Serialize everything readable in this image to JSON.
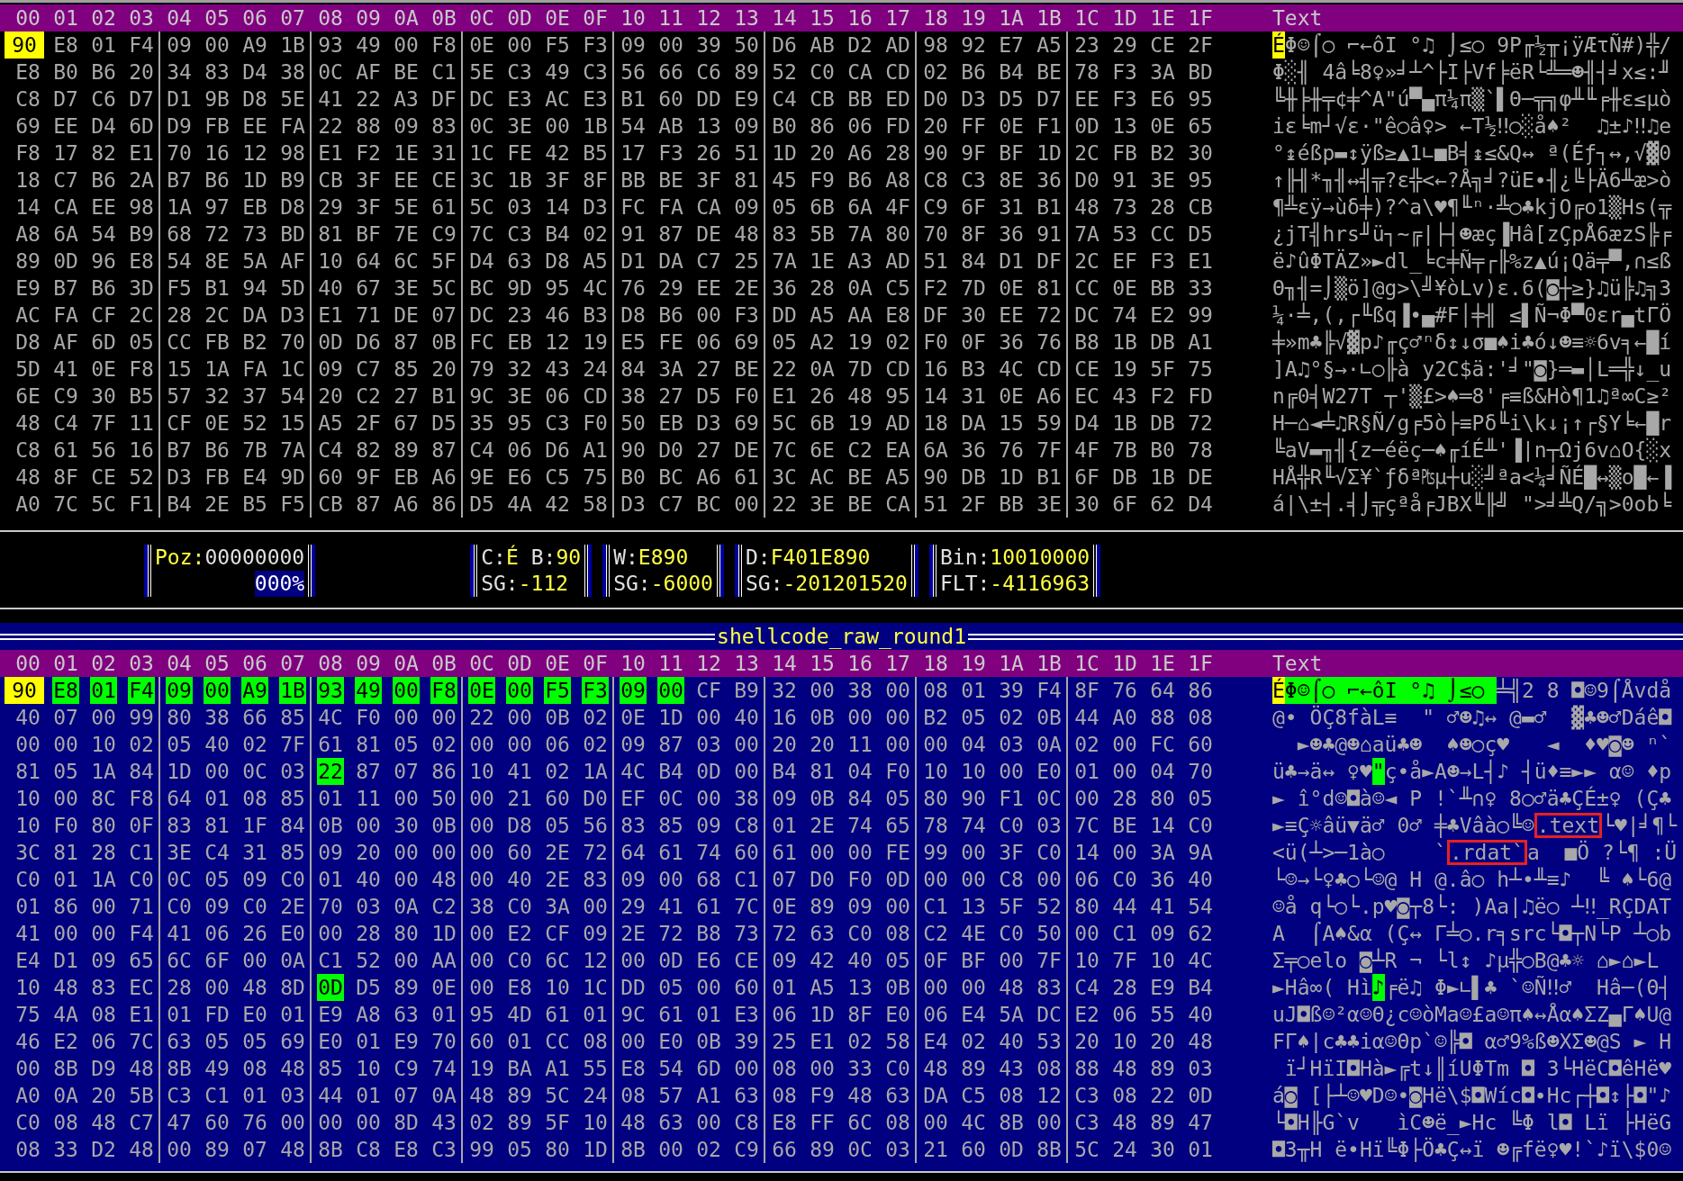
{
  "top_pane": {
    "columns": [
      "00",
      "01",
      "02",
      "03",
      "04",
      "05",
      "06",
      "07",
      "08",
      "09",
      "0A",
      "0B",
      "0C",
      "0D",
      "0E",
      "0F",
      "10",
      "11",
      "12",
      "13",
      "14",
      "15",
      "16",
      "17",
      "18",
      "19",
      "1A",
      "1B",
      "1C",
      "1D",
      "1E",
      "1F"
    ],
    "text_heading": "Text",
    "rows": [
      {
        "hex": [
          "90",
          "E8",
          "01",
          "F4",
          "09",
          "00",
          "A9",
          "1B",
          "93",
          "49",
          "00",
          "F8",
          "0E",
          "00",
          "F5",
          "F3",
          "09",
          "00",
          "39",
          "50",
          "D6",
          "AB",
          "D2",
          "AD",
          "98",
          "92",
          "E7",
          "A5",
          "23",
          "29",
          "CE",
          "2F"
        ],
        "hex_cursor": [
          true,
          false,
          false,
          false,
          false,
          false,
          false,
          false,
          false,
          false,
          false,
          false,
          false,
          false,
          false,
          false,
          false,
          false,
          false,
          false,
          false,
          false,
          false,
          false,
          false,
          false,
          false,
          false,
          false,
          false,
          false,
          false
        ],
        "segments": [
          {
            "text": "É",
            "kind": "cursor"
          },
          {
            "text": "Φ☺⌠○ ⌐←ôI °♫ ⌡≤○ 9P╓½╥¡ÿÆτÑ#)╬/",
            "kind": "plain"
          }
        ]
      },
      {
        "hex": [
          "E8",
          "B0",
          "B6",
          "20",
          "34",
          "83",
          "D4",
          "38",
          "0C",
          "AF",
          "BE",
          "C1",
          "5E",
          "C3",
          "49",
          "C3",
          "56",
          "66",
          "C6",
          "89",
          "52",
          "C0",
          "CA",
          "CD",
          "02",
          "B6",
          "B4",
          "BE",
          "78",
          "F3",
          "3A",
          "BD"
        ],
        "text": "Φ░╢ 4â╘8♀»╛┴^├I├Vf╞ëR└╩═☻╢┤╛x≤:╜"
      },
      {
        "hex": [
          "C8",
          "D7",
          "C6",
          "D7",
          "D1",
          "9B",
          "D8",
          "5E",
          "41",
          "22",
          "A3",
          "DF",
          "DC",
          "E3",
          "AC",
          "E3",
          "B1",
          "60",
          "DD",
          "E9",
          "C4",
          "CB",
          "BB",
          "ED",
          "D0",
          "D3",
          "D5",
          "D7",
          "EE",
          "F3",
          "E6",
          "95"
        ],
        "text": "╚╫╞╫╤¢╪^A\"ú▀▄π¼π▒`▌Θ─╦╗φ╨╙╒╫ε≤µò"
      },
      {
        "hex": [
          "69",
          "EE",
          "D4",
          "6D",
          "D9",
          "FB",
          "EE",
          "FA",
          "22",
          "88",
          "09",
          "83",
          "0C",
          "3E",
          "00",
          "1B",
          "54",
          "AB",
          "13",
          "09",
          "B0",
          "86",
          "06",
          "FD",
          "20",
          "FF",
          "0E",
          "F1",
          "0D",
          "13",
          "0E",
          "65"
        ],
        "text": "iε╘m┘√ε·\"ê○â♀> ←T½‼○░å♠²  ♫±♪‼♫e"
      },
      {
        "hex": [
          "F8",
          "17",
          "82",
          "E1",
          "70",
          "16",
          "12",
          "98",
          "E1",
          "F2",
          "1E",
          "31",
          "1C",
          "FE",
          "42",
          "B5",
          "17",
          "F3",
          "26",
          "51",
          "1D",
          "20",
          "A6",
          "28",
          "90",
          "9F",
          "BF",
          "1D",
          "2C",
          "FB",
          "B2",
          "30"
        ],
        "text": "°↨éßp▬↕ÿß≥▲1∟■B╡↨≤&Q↔ ª(Éƒ┐↔,√▓0"
      },
      {
        "hex": [
          "18",
          "C7",
          "B6",
          "2A",
          "B7",
          "B6",
          "1D",
          "B9",
          "CB",
          "3F",
          "EE",
          "CE",
          "3C",
          "1B",
          "3F",
          "8F",
          "BB",
          "BE",
          "3F",
          "81",
          "45",
          "F9",
          "B6",
          "A8",
          "C8",
          "C3",
          "8E",
          "36",
          "D0",
          "91",
          "3E",
          "95"
        ],
        "text": "↑╟╢*╖╢↔╣╦?ε╬<←?Å╗╛?üE∙╢¿╚├Ä6╨æ>ò"
      },
      {
        "hex": [
          "14",
          "CA",
          "EE",
          "98",
          "1A",
          "97",
          "EB",
          "D8",
          "29",
          "3F",
          "5E",
          "61",
          "5C",
          "03",
          "14",
          "D3",
          "FC",
          "FA",
          "CA",
          "09",
          "05",
          "6B",
          "6A",
          "4F",
          "C9",
          "6F",
          "31",
          "B1",
          "48",
          "73",
          "28",
          "CB"
        ],
        "text": "¶╩εÿ→ùδ╪)?^a\\♥¶╙ⁿ·╩○♣kjO╔o1▒Hs(╦"
      },
      {
        "hex": [
          "A8",
          "6A",
          "54",
          "B9",
          "68",
          "72",
          "73",
          "BD",
          "81",
          "BF",
          "7E",
          "C9",
          "7C",
          "C3",
          "B4",
          "02",
          "91",
          "87",
          "DE",
          "48",
          "83",
          "5B",
          "7A",
          "80",
          "70",
          "8F",
          "36",
          "91",
          "7A",
          "53",
          "CC",
          "D5"
        ],
        "text": "¿jT╣hrs╜ü┐~╔|├┤☻æç▐Hâ[zÇpÅ6æzS╠╒"
      },
      {
        "hex": [
          "89",
          "0D",
          "96",
          "E8",
          "54",
          "8E",
          "5A",
          "AF",
          "10",
          "64",
          "6C",
          "5F",
          "D4",
          "63",
          "D8",
          "A5",
          "D1",
          "DA",
          "C7",
          "25",
          "7A",
          "1E",
          "A3",
          "AD",
          "51",
          "84",
          "D1",
          "DF",
          "2C",
          "EF",
          "F3",
          "E1"
        ],
        "text": "ë♪ûΦTÄZ»►dl_╘c╪Ñ╤┌╟%z▲ú¡Qä╤▀,∩≤ß"
      },
      {
        "hex": [
          "E9",
          "B7",
          "B6",
          "3D",
          "F5",
          "B1",
          "94",
          "5D",
          "40",
          "67",
          "3E",
          "5C",
          "BC",
          "9D",
          "95",
          "4C",
          "76",
          "29",
          "EE",
          "2E",
          "36",
          "28",
          "0A",
          "C5",
          "F2",
          "7D",
          "0E",
          "81",
          "CC",
          "0E",
          "BB",
          "33"
        ],
        "text": "Θ╖╢=⌡▒ö]@g>\\╝¥òLv)ε.6(◙┼≥}♫ü╠♫╗3"
      },
      {
        "hex": [
          "AC",
          "FA",
          "CF",
          "2C",
          "28",
          "2C",
          "DA",
          "D3",
          "E1",
          "71",
          "DE",
          "07",
          "DC",
          "23",
          "46",
          "B3",
          "D8",
          "B6",
          "00",
          "F3",
          "DD",
          "A5",
          "AA",
          "E8",
          "DF",
          "30",
          "EE",
          "72",
          "DC",
          "74",
          "E2",
          "99"
        ],
        "text": "¼·╧,(,┌╙ßq▐•▄#F│╪╢ ≤▌Ñ¬Φ▀0εr▄tΓÖ"
      },
      {
        "hex": [
          "D8",
          "AF",
          "6D",
          "05",
          "CC",
          "FB",
          "B2",
          "70",
          "0D",
          "D6",
          "87",
          "0B",
          "FC",
          "EB",
          "12",
          "19",
          "E5",
          "FE",
          "06",
          "69",
          "05",
          "A2",
          "19",
          "02",
          "F0",
          "0F",
          "36",
          "76",
          "B8",
          "1B",
          "DB",
          "A1"
        ],
        "text": "╪»m♣╠√▓p♪╓ç♂ⁿδ↕↓σ■♠i♣ó↓☻≡☼6v╕←█í"
      },
      {
        "hex": [
          "5D",
          "41",
          "0E",
          "F8",
          "15",
          "1A",
          "FA",
          "1C",
          "09",
          "C7",
          "85",
          "20",
          "79",
          "32",
          "43",
          "24",
          "84",
          "3A",
          "27",
          "BE",
          "22",
          "0A",
          "7D",
          "CD",
          "16",
          "B3",
          "4C",
          "CD",
          "CE",
          "19",
          "5F",
          "75"
        ],
        "text": "]A♫°§→·∟○╟à y2C$ä:'╛\"◙}═▬│L═╬↓_u"
      },
      {
        "hex": [
          "6E",
          "C9",
          "30",
          "B5",
          "57",
          "32",
          "37",
          "54",
          "20",
          "C2",
          "27",
          "B1",
          "9C",
          "3E",
          "06",
          "CD",
          "38",
          "27",
          "D5",
          "F0",
          "E1",
          "26",
          "48",
          "95",
          "14",
          "31",
          "0E",
          "A6",
          "EC",
          "43",
          "F2",
          "FD"
        ],
        "text": "n╔0╡W27T ┬'▒£>♠═8'╒≡ß&Hò¶1♫ª∞C≥²"
      },
      {
        "hex": [
          "48",
          "C4",
          "7F",
          "11",
          "CF",
          "0E",
          "52",
          "15",
          "A5",
          "2F",
          "67",
          "D5",
          "35",
          "95",
          "C3",
          "F0",
          "50",
          "EB",
          "D3",
          "69",
          "5C",
          "6B",
          "19",
          "AD",
          "18",
          "DA",
          "15",
          "59",
          "D4",
          "1B",
          "DB",
          "72"
        ],
        "text": "H─⌂◄╧♫R§Ñ/g╒5ò├≡Pδ╙i\\k↓¡↑┌§Y╘←█r"
      },
      {
        "hex": [
          "C8",
          "61",
          "56",
          "16",
          "B7",
          "B6",
          "7B",
          "7A",
          "C4",
          "82",
          "89",
          "87",
          "C4",
          "06",
          "D6",
          "A1",
          "90",
          "D0",
          "27",
          "DE",
          "7C",
          "6E",
          "C2",
          "EA",
          "6A",
          "36",
          "76",
          "7F",
          "4F",
          "7B",
          "B0",
          "78"
        ],
        "text": "╚aV▬╖╢{z─éëç─♠╓íÉ╨'▐|n┬Ωj6v⌂O{░x"
      },
      {
        "hex": [
          "48",
          "8F",
          "CE",
          "52",
          "D3",
          "FB",
          "E4",
          "9D",
          "60",
          "9F",
          "EB",
          "A6",
          "9E",
          "E6",
          "C5",
          "75",
          "B0",
          "BC",
          "A6",
          "61",
          "3C",
          "AC",
          "BE",
          "A5",
          "90",
          "DB",
          "1D",
          "B1",
          "6F",
          "DB",
          "1B",
          "DE"
        ],
        "text": "HÅ╬R╙√Σ¥`ƒδª₧µ┼u░╝ªa<¼╛ÑÉ█↔▒o█←▐"
      },
      {
        "hex": [
          "A0",
          "7C",
          "5C",
          "F1",
          "B4",
          "2E",
          "B5",
          "F5",
          "CB",
          "87",
          "A6",
          "86",
          "D5",
          "4A",
          "42",
          "58",
          "D3",
          "C7",
          "BC",
          "00",
          "22",
          "3E",
          "BE",
          "CA",
          "51",
          "2F",
          "BB",
          "3E",
          "30",
          "6F",
          "62",
          "D4"
        ],
        "text": "á|\\±┤.╡⌡╦çªå╒JBX╙╟╝ \">╛╩Q/╗>0ob╘"
      }
    ]
  },
  "status": {
    "boxes": [
      {
        "lines": [
          {
            "parts": [
              {
                "text": "Poz:",
                "kind": "accent"
              },
              {
                "text": "00000000",
                "kind": "plain"
              }
            ]
          },
          {
            "parts": [
              {
                "text": "000%",
                "kind": "inverse"
              }
            ]
          }
        ]
      },
      {
        "lines": [
          {
            "parts": [
              {
                "text": "C:",
                "kind": "label"
              },
              {
                "text": "É",
                "kind": "value"
              },
              {
                "text": "B:",
                "kind": "label"
              },
              {
                "text": "90",
                "kind": "value"
              }
            ]
          },
          {
            "parts": [
              {
                "text": "SG:",
                "kind": "label"
              },
              {
                "text": "-112",
                "kind": "value"
              }
            ]
          }
        ]
      },
      {
        "lines": [
          {
            "parts": [
              {
                "text": "W:",
                "kind": "label"
              },
              {
                "text": "E890",
                "kind": "value"
              }
            ]
          },
          {
            "parts": [
              {
                "text": "SG:",
                "kind": "label"
              },
              {
                "text": "-6000",
                "kind": "value"
              }
            ]
          }
        ]
      },
      {
        "lines": [
          {
            "parts": [
              {
                "text": "D:",
                "kind": "label"
              },
              {
                "text": "F401E890",
                "kind": "value"
              }
            ]
          },
          {
            "parts": [
              {
                "text": "SG:",
                "kind": "label"
              },
              {
                "text": "-201201520",
                "kind": "value"
              }
            ]
          }
        ]
      },
      {
        "lines": [
          {
            "parts": [
              {
                "text": "Bin:",
                "kind": "label"
              },
              {
                "text": "10010000",
                "kind": "value"
              }
            ]
          },
          {
            "parts": [
              {
                "text": "FLT:",
                "kind": "label"
              },
              {
                "text": "-4116963",
                "kind": "value"
              }
            ]
          }
        ]
      }
    ]
  },
  "bottom_pane": {
    "title": "shellcode_raw_round1",
    "columns": [
      "00",
      "01",
      "02",
      "03",
      "04",
      "05",
      "06",
      "07",
      "08",
      "09",
      "0A",
      "0B",
      "0C",
      "0D",
      "0E",
      "0F",
      "10",
      "11",
      "12",
      "13",
      "14",
      "15",
      "16",
      "17",
      "18",
      "19",
      "1A",
      "1B",
      "1C",
      "1D",
      "1E",
      "1F"
    ],
    "text_heading": "Text",
    "rows": [
      {
        "hex": [
          "90",
          "E8",
          "01",
          "F4",
          "09",
          "00",
          "A9",
          "1B",
          "93",
          "49",
          "00",
          "F8",
          "0E",
          "00",
          "F5",
          "F3",
          "09",
          "00",
          "CF",
          "B9",
          "32",
          "00",
          "38",
          "00",
          "08",
          "01",
          "39",
          "F4",
          "8F",
          "76",
          "64",
          "86"
        ],
        "hex_cursor": [
          true,
          false,
          false,
          false,
          false,
          false,
          false,
          false,
          false,
          false,
          false,
          false,
          false,
          false,
          false,
          false,
          false,
          false,
          false,
          false,
          false,
          false,
          false,
          false,
          false,
          false,
          false,
          false,
          false,
          false,
          false,
          false
        ],
        "hex_selected": [
          false,
          true,
          true,
          true,
          true,
          true,
          true,
          true,
          true,
          true,
          true,
          true,
          true,
          true,
          true,
          true,
          true,
          true,
          false,
          false,
          false,
          false,
          false,
          false,
          false,
          false,
          false,
          false,
          false,
          false,
          false,
          false
        ],
        "segments": [
          {
            "text": "É",
            "kind": "cursor"
          },
          {
            "text": "Φ☺⌠○ ⌐←ôI °♫ ⌡≤○ ",
            "kind": "selection"
          },
          {
            "text": "╧╣2 8 ◘☺9⌠Åvdå",
            "kind": "plain"
          }
        ]
      },
      {
        "hex": [
          "40",
          "07",
          "00",
          "99",
          "80",
          "38",
          "66",
          "85",
          "4C",
          "F0",
          "00",
          "00",
          "22",
          "00",
          "0B",
          "02",
          "0E",
          "1D",
          "00",
          "40",
          "16",
          "0B",
          "00",
          "00",
          "B2",
          "05",
          "02",
          "0B",
          "44",
          "A0",
          "88",
          "08"
        ],
        "text": "@• ÖÇ8fàL≡  \" ♂☻♫↔ @▬♂  ▓♣☻♂Dáê◘"
      },
      {
        "hex": [
          "00",
          "00",
          "10",
          "02",
          "05",
          "40",
          "02",
          "7F",
          "61",
          "81",
          "05",
          "02",
          "00",
          "00",
          "06",
          "02",
          "09",
          "87",
          "03",
          "00",
          "20",
          "20",
          "11",
          "00",
          "00",
          "04",
          "03",
          "0A",
          "02",
          "00",
          "FC",
          "60"
        ],
        "text": "  ►☻♣@☻⌂aü♣☻  ♠☻○ç♥   ◄  ♦♥◙☻ ⁿ`"
      },
      {
        "hex": [
          "81",
          "05",
          "1A",
          "84",
          "1D",
          "00",
          "0C",
          "03",
          "22",
          "87",
          "07",
          "86",
          "10",
          "41",
          "02",
          "1A",
          "4C",
          "B4",
          "0D",
          "00",
          "B4",
          "81",
          "04",
          "F0",
          "10",
          "10",
          "00",
          "E0",
          "01",
          "00",
          "04",
          "70"
        ],
        "hex_selected": [
          false,
          false,
          false,
          false,
          false,
          false,
          false,
          false,
          true,
          false,
          false,
          false,
          false,
          false,
          false,
          false,
          false,
          false,
          false,
          false,
          false,
          false,
          false,
          false,
          false,
          false,
          false,
          false,
          false,
          false,
          false,
          false
        ],
        "segments": [
          {
            "text": "ü♣→ä↔ ♀♥",
            "kind": "plain"
          },
          {
            "text": "\"",
            "kind": "selection"
          },
          {
            "text": "ç•å►A☻→L┤♪ ┤ü♦≡►► α☺ ♦p",
            "kind": "plain"
          }
        ]
      },
      {
        "hex": [
          "10",
          "00",
          "8C",
          "F8",
          "64",
          "01",
          "08",
          "85",
          "01",
          "11",
          "00",
          "50",
          "00",
          "21",
          "60",
          "D0",
          "EF",
          "0C",
          "00",
          "38",
          "09",
          "0B",
          "84",
          "05",
          "80",
          "90",
          "F1",
          "0C",
          "00",
          "28",
          "80",
          "05"
        ],
        "text": "► î°d☺◘à☺◄ P !`╨∩♀ 8○♂ä♣ÇÉ±♀ (Ç♣"
      },
      {
        "hex": [
          "10",
          "F0",
          "80",
          "0F",
          "83",
          "81",
          "1F",
          "84",
          "0B",
          "00",
          "30",
          "0B",
          "00",
          "D8",
          "05",
          "56",
          "83",
          "85",
          "09",
          "C8",
          "01",
          "2E",
          "74",
          "65",
          "78",
          "74",
          "C0",
          "03",
          "7C",
          "BE",
          "14",
          "C0"
        ],
        "segments": [
          {
            "text": "►≡Ç☼âü▼ä♂ 0♂ ╪♣Vâà○╚☺",
            "kind": "plain"
          },
          {
            "text": ".text",
            "kind": "annotated"
          },
          {
            "text": "└♥|╛¶└",
            "kind": "plain"
          }
        ]
      },
      {
        "hex": [
          "3C",
          "81",
          "28",
          "C1",
          "3E",
          "C4",
          "31",
          "85",
          "09",
          "20",
          "00",
          "00",
          "00",
          "60",
          "2E",
          "72",
          "64",
          "61",
          "74",
          "60",
          "61",
          "00",
          "00",
          "FE",
          "99",
          "00",
          "3F",
          "C0",
          "14",
          "00",
          "3A",
          "9A"
        ],
        "segments": [
          {
            "text": "<ü(┴>─1à○    `",
            "kind": "plain"
          },
          {
            "text": ".rdat`",
            "kind": "annotated"
          },
          {
            "text": "a  ■Ö ?└¶ :Ü",
            "kind": "plain"
          }
        ]
      },
      {
        "hex": [
          "C0",
          "01",
          "1A",
          "C0",
          "0C",
          "05",
          "09",
          "C0",
          "01",
          "40",
          "00",
          "48",
          "00",
          "40",
          "2E",
          "83",
          "09",
          "00",
          "68",
          "C1",
          "07",
          "D0",
          "F0",
          "0D",
          "00",
          "00",
          "C8",
          "00",
          "06",
          "C0",
          "36",
          "40"
        ],
        "text": "└☺→└♀♣○└☺@ H @.â○ h┴•╨≡♪  ╚ ♠└6@"
      },
      {
        "hex": [
          "01",
          "86",
          "00",
          "71",
          "C0",
          "09",
          "C0",
          "2E",
          "70",
          "03",
          "0A",
          "C2",
          "38",
          "C0",
          "3A",
          "00",
          "29",
          "41",
          "61",
          "7C",
          "0E",
          "89",
          "09",
          "00",
          "C1",
          "13",
          "5F",
          "52",
          "80",
          "44",
          "41",
          "54"
        ],
        "text": "☺å q└○└.p♥◙┬8└: )Aa|♫ë○ ┴‼_RÇDAT"
      },
      {
        "hex": [
          "41",
          "00",
          "00",
          "F4",
          "41",
          "06",
          "26",
          "E0",
          "00",
          "28",
          "80",
          "1D",
          "00",
          "E2",
          "CF",
          "09",
          "2E",
          "72",
          "B8",
          "73",
          "72",
          "63",
          "C0",
          "08",
          "C2",
          "4E",
          "C0",
          "50",
          "00",
          "C1",
          "09",
          "62"
        ],
        "text": "A  ⌠A♠&α (Ç↔ Γ╧○.r╕src└◘┬N└P ┴○b"
      },
      {
        "hex": [
          "E4",
          "D1",
          "09",
          "65",
          "6C",
          "6F",
          "00",
          "0A",
          "C1",
          "52",
          "00",
          "AA",
          "00",
          "C0",
          "6C",
          "12",
          "00",
          "0D",
          "E6",
          "CE",
          "09",
          "42",
          "40",
          "05",
          "0F",
          "BF",
          "00",
          "7F",
          "10",
          "7F",
          "10",
          "4C"
        ],
        "text": "Σ╤○elo ◙┴R ¬ └l↕ ♪µ╬○B@♣☼ ⌂►⌂►L"
      },
      {
        "hex": [
          "10",
          "48",
          "83",
          "EC",
          "28",
          "00",
          "48",
          "8D",
          "0D",
          "D5",
          "89",
          "0E",
          "00",
          "E8",
          "10",
          "1C",
          "DD",
          "05",
          "00",
          "60",
          "01",
          "A5",
          "13",
          "0B",
          "00",
          "00",
          "48",
          "83",
          "C4",
          "28",
          "E9",
          "B4"
        ],
        "hex_selected": [
          false,
          false,
          false,
          false,
          false,
          false,
          false,
          false,
          true,
          false,
          false,
          false,
          false,
          false,
          false,
          false,
          false,
          false,
          false,
          false,
          false,
          false,
          false,
          false,
          false,
          false,
          false,
          false,
          false,
          false,
          false,
          false
        ],
        "segments": [
          {
            "text": "►Hâ∞( Hì",
            "kind": "plain"
          },
          {
            "text": "♪",
            "kind": "selection"
          },
          {
            "text": "╒ë♫ Φ►∟▌♣ `☺Ñ‼♂  Hâ─(Θ┤",
            "kind": "plain"
          }
        ]
      },
      {
        "hex": [
          "75",
          "4A",
          "08",
          "E1",
          "01",
          "FD",
          "E0",
          "01",
          "E9",
          "A8",
          "63",
          "01",
          "95",
          "4D",
          "61",
          "01",
          "9C",
          "61",
          "01",
          "E3",
          "06",
          "1D",
          "8F",
          "E0",
          "06",
          "E4",
          "5A",
          "DC",
          "E2",
          "06",
          "55",
          "40"
        ],
        "text": "uJ◘ß☺²α☺Θ¿c☺òMa☺£a☺π♠↔Åα♠ΣZ▄Γ♠U@"
      },
      {
        "hex": [
          "46",
          "E2",
          "06",
          "7C",
          "63",
          "05",
          "05",
          "69",
          "E0",
          "01",
          "E9",
          "70",
          "60",
          "01",
          "CC",
          "08",
          "00",
          "E0",
          "0B",
          "39",
          "25",
          "E1",
          "02",
          "58",
          "E4",
          "02",
          "40",
          "53",
          "20",
          "10",
          "20",
          "48"
        ],
        "text": "FΓ♠|c♣♣iα☺Θp`☺╠◘ α♂9%ß☻XΣ☻@S ► H"
      },
      {
        "hex": [
          "00",
          "8B",
          "D9",
          "48",
          "8B",
          "49",
          "08",
          "48",
          "85",
          "10",
          "C9",
          "74",
          "19",
          "BA",
          "A1",
          "55",
          "E8",
          "54",
          "6D",
          "00",
          "08",
          "00",
          "33",
          "C0",
          "48",
          "89",
          "43",
          "08",
          "88",
          "48",
          "89",
          "03"
        ],
        "text": " ï┘HïI◘Hà►╔t↓║íUΦTm ◘ 3└HëC◘êHë♥"
      },
      {
        "hex": [
          "A0",
          "0A",
          "20",
          "5B",
          "C3",
          "C1",
          "01",
          "03",
          "44",
          "01",
          "07",
          "0A",
          "48",
          "89",
          "5C",
          "24",
          "08",
          "57",
          "A1",
          "63",
          "08",
          "F9",
          "48",
          "63",
          "DA",
          "C5",
          "08",
          "12",
          "C3",
          "08",
          "22",
          "0D"
        ],
        "text": "á◙ [├┴☺♥D☺•◙Hë\\$◘Wíc◘∙Hc┌┼◘↕├◘\"♪"
      },
      {
        "hex": [
          "C0",
          "08",
          "48",
          "C7",
          "47",
          "60",
          "76",
          "00",
          "00",
          "00",
          "8D",
          "43",
          "02",
          "89",
          "5F",
          "10",
          "48",
          "63",
          "00",
          "C8",
          "E8",
          "FF",
          "6C",
          "08",
          "00",
          "4C",
          "8B",
          "00",
          "C3",
          "48",
          "89",
          "47"
        ],
        "text": "└◘H╟G`v   ìC☻ë_►Hc ╚Φ l◘ Lï ├HëG"
      },
      {
        "hex": [
          "08",
          "33",
          "D2",
          "48",
          "00",
          "89",
          "07",
          "48",
          "8B",
          "C8",
          "E8",
          "C3",
          "99",
          "05",
          "80",
          "1D",
          "8B",
          "00",
          "02",
          "C9",
          "66",
          "89",
          "0C",
          "03",
          "21",
          "60",
          "0D",
          "8B",
          "5C",
          "24",
          "30",
          "01"
        ],
        "text": "◘3╥H ë•Hï╚Φ├Ö♣Ç↔ï ☻╔fë♀♥!`♪ï\\$0☺"
      }
    ]
  }
}
